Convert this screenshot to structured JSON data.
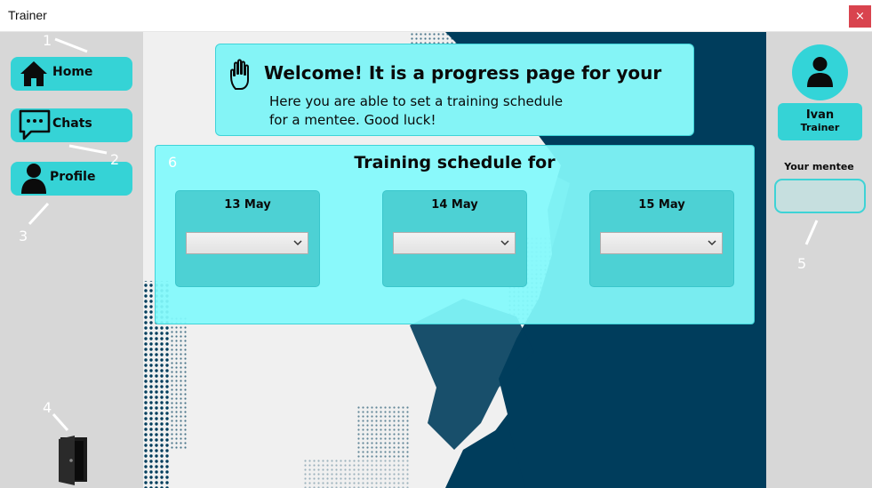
{
  "window": {
    "title": "Trainer",
    "close_glyph": "×"
  },
  "sidebar": {
    "items": [
      {
        "label": "Home",
        "icon": "home-icon"
      },
      {
        "label": "Chats",
        "icon": "chat-icon"
      },
      {
        "label": "Profile",
        "icon": "user-icon"
      }
    ],
    "exit_icon": "door-exit-icon"
  },
  "welcome": {
    "title": "Welcome! It is a progress page for your",
    "line1": "Here you are able to set a training schedule",
    "line2": "for a mentee. Good luck!",
    "icon": "hand-icon"
  },
  "schedule": {
    "title": "Training schedule for",
    "days": [
      {
        "label": "13 May",
        "selected": ""
      },
      {
        "label": "14 May",
        "selected": ""
      },
      {
        "label": "15 May",
        "selected": ""
      }
    ]
  },
  "profile": {
    "name": "Ivan",
    "role": "Trainer",
    "mentee_label": "Your mentee",
    "mentee_value": ""
  },
  "annotations": [
    "1",
    "2",
    "3",
    "4",
    "5",
    "6"
  ],
  "colors": {
    "accent": "#35d3d6",
    "panel": "#84f4f6",
    "sidebar": "#d7d7d7",
    "dark_bg": "#003d5c",
    "close": "#d9434e"
  }
}
